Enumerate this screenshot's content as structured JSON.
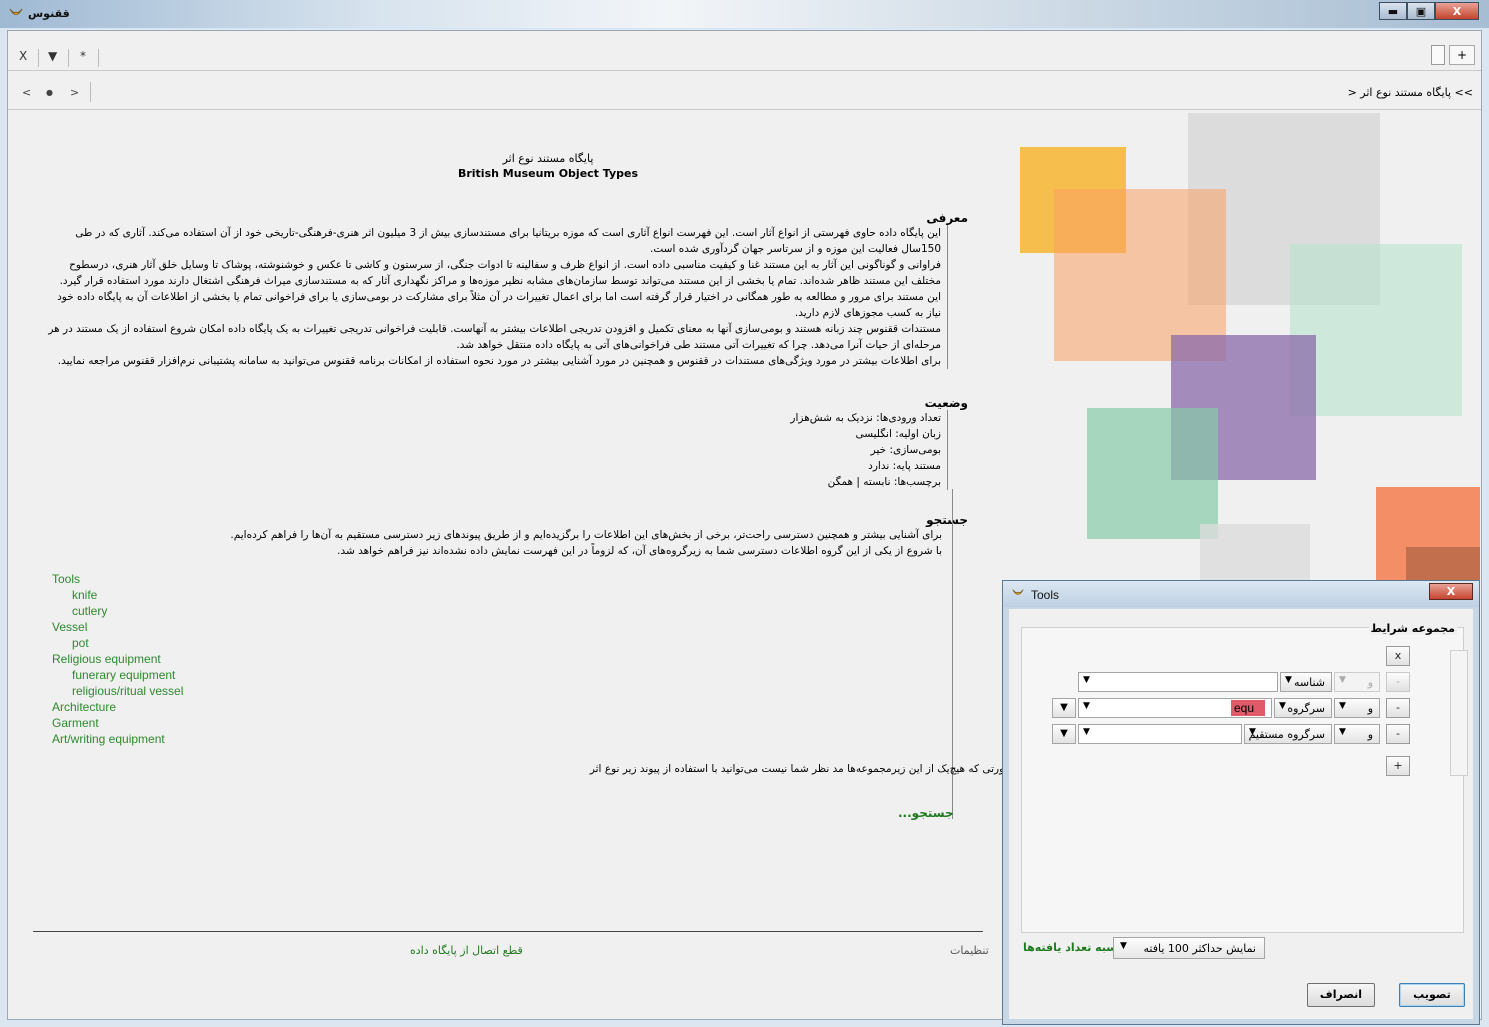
{
  "app": {
    "title": "ققنوس"
  },
  "window_controls": {
    "minimize": "▬",
    "maximize": "▣",
    "close": "X"
  },
  "tabs": {
    "close": "X",
    "dropdown": "▼",
    "star": "*",
    "add": "+"
  },
  "nav": {
    "back": "<",
    "dot": "●",
    "forward": ">",
    "breadcrumb": ">>  پایگاه مستند نوع اثر  <"
  },
  "doc": {
    "title_fa": "پایگاه مستند نوع اثر",
    "title_en": "British Museum Object Types",
    "intro_heading": "معرفی",
    "intro_p1": "این پایگاه داده حاوی فهرستی از انواع آثار است. این فهرست انواع آثاری است که موزه بریتانیا برای مستندسازی بیش از 3 میلیون اثر هنری-فرهنگی-تاریخی خود از آن استفاده می‌کند. آثاری که در طی 150سال فعالیت این موزه و از سرتاسر جهان گردآوری شده است.",
    "intro_p2": "فراوانی و گوناگونی این آثار به این مستند غنا و کیفیت مناسبی داده است. از انواع ظرف و سفالینه تا ادوات جنگی، از سرستون و کاشی تا عکس و خوشنوشته، پوشاک تا وسایل خلق آثار هنری، درسطوح مختلف این مستند ظاهر شده‌اند. تمام یا بخشی از این مستند می‌تواند توسط سازمان‌های مشابه نظیر موزه‌ها و مراکز نگهداری آثار که به مستندسازی میراث فرهنگی اشتغال دارند مورد استفاده قرار گیرد.",
    "intro_p3": "این مستند برای مرور و مطالعه به طور همگانی در اختیار قرار گرفته است اما برای اعمال تغییرات در آن مثلاً برای مشارکت در بومی‌سازی یا برای فراخوانی تمام یا بخشی از اطلاعات آن به پایگاه داده خود نیاز به کسب مجوزهای لازم دارید.",
    "intro_p4": "مستندات ققنوس چند زبانه هستند و بومی‌سازی آنها به معنای تکمیل و افزودن تدریجی اطلاعات بیشتر به آنهاست. قابلیت فراخوانی تدریجی تغییرات به یک پایگاه داده امکان شروع استفاده از یک مستند در هر مرحله‌ای از حیات آنرا می‌دهد. چرا که تغییرات آتی مستند طی فراخوانی‌های آتی به پایگاه داده منتقل خواهد شد.",
    "intro_p5": "برای اطلاعات بیشتر در مورد ویژگی‌های مستندات در ققنوس و همچنین در مورد آشنایی بیشتر در مورد نحوه استفاده از امکانات برنامه ققنوس می‌توانید به سامانه پشتیبانی نرم‌افزار ققنوس مراجعه نمایید.",
    "status_heading": "وضعیت",
    "status_entries": "تعداد ورودی‌ها: نزدیک به شش‌هزار",
    "status_language": "زبان اولیه: انگلیسی",
    "status_localization": "بومی‌سازی: خیر",
    "status_base": "مستند پایه: ندارد",
    "status_tags": "برچسب‌ها: نابسته | همگن",
    "search_heading": "جستجو",
    "search_p1": "برای آشنایی بیشتر و همچنین دسترسی راحت‌تر، برخی از بخش‌های این اطلاعات را برگزیده‌ایم و از طریق پیوندهای زیر دسترسی مستقیم به آن‌ها را فراهم کرده‌ایم.",
    "search_p2": "با شروع از یکی از این گروه اطلاعات دسترسی شما به زیرگروه‌های آن، که لزوماً در این فهرست نمایش داده نشده‌اند نیز فراهم خواهد شد.",
    "tree": [
      {
        "label": "Tools",
        "children": [
          "knife",
          "cutlery"
        ]
      },
      {
        "label": "Vessel",
        "children": [
          "pot"
        ]
      },
      {
        "label": "Religious equipment",
        "children": [
          "funerary equipment",
          "religious/ritual vessel"
        ]
      },
      {
        "label": "Architecture",
        "children": []
      },
      {
        "label": "Garment",
        "children": []
      },
      {
        "label": "Art/writing equipment",
        "children": []
      }
    ],
    "search_note": "پیوندهای بالا دسترسی شما به بخش معدودای از اطلاعات موجود در این پایگاه را فراهم می‌کند. در صورتی که هیچ‌یک از این زیرمجموعه‌ها مد نظر شما نیست می‌توانید با استفاده از پیوند زیر نوع اثر موردنظر خود را در کل اطلاعات موجود جستجو نمایید.",
    "search_link": "جستجو..."
  },
  "footer": {
    "settings": "تنظیمات",
    "disconnect": "قطع اتصال از پایگاه داده"
  },
  "dialog": {
    "title": "Tools",
    "close": "X",
    "group_label": "مجموعه شرایط",
    "remove_group": "x",
    "add_row": "+",
    "rows": [
      {
        "connector": "و",
        "field": "شناسه",
        "value": "",
        "remove": "-"
      },
      {
        "connector": "و",
        "field": "سرگروه",
        "value": "equ",
        "remove": "-"
      },
      {
        "connector": "و",
        "field": "سرگروه مستقیم",
        "value": "",
        "remove": "-"
      }
    ],
    "count_link": "محاسبه تعداد یافته‌ها",
    "max_results": "نمایش حداکثر 100 یافته",
    "ok": "تصویب",
    "cancel": "انصراف"
  }
}
